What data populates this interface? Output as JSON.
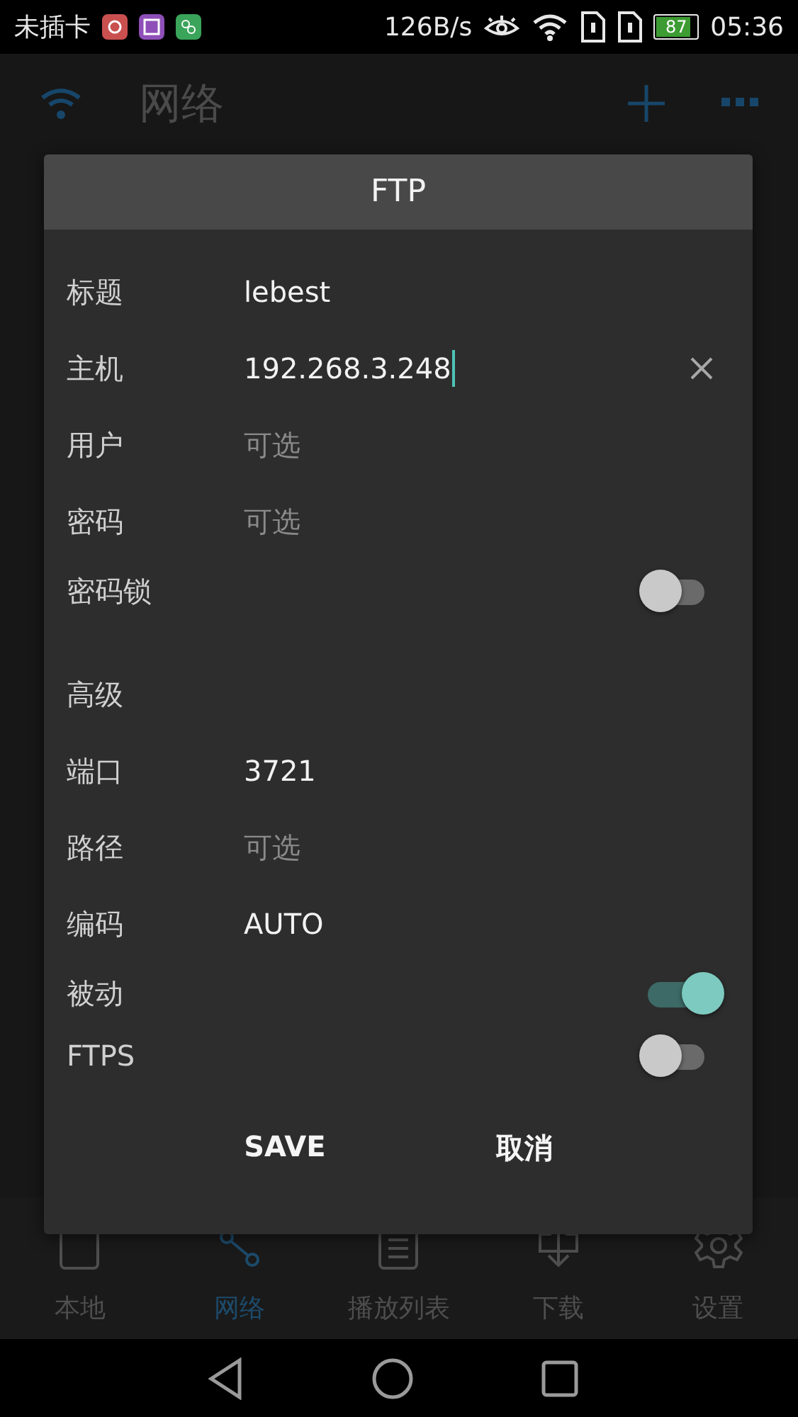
{
  "status_bar": {
    "carrier": "未插卡",
    "speed": "126B/s",
    "battery": {
      "reading": "87",
      "level": 0.87
    },
    "time": "05:36"
  },
  "app_bar": {
    "title": "网络"
  },
  "dialog": {
    "title": "FTP",
    "rows": [
      {
        "kind": "text",
        "label": "标题",
        "value": "lebest",
        "focused": false
      },
      {
        "kind": "text",
        "label": "主机",
        "value": "192.268.3.248",
        "focused": true
      },
      {
        "kind": "text",
        "label": "用户",
        "placeholder": "可选",
        "focused": false
      },
      {
        "kind": "text",
        "label": "密码",
        "placeholder": "可选",
        "focused": false
      },
      {
        "kind": "toggle",
        "label": "密码锁",
        "on": false
      },
      {
        "kind": "section",
        "label": "高级"
      },
      {
        "kind": "text",
        "label": "端口",
        "value": "3721",
        "focused": false
      },
      {
        "kind": "text",
        "label": "路径",
        "placeholder": "可选",
        "focused": false
      },
      {
        "kind": "text",
        "label": "编码",
        "value": "AUTO",
        "focused": false
      },
      {
        "kind": "toggle",
        "label": "被动",
        "on": true
      },
      {
        "kind": "toggle",
        "label": "FTPS",
        "on": false
      }
    ],
    "buttons": [
      "SAVE",
      "取消"
    ]
  },
  "bottom_nav": [
    {
      "label": "本地",
      "kind": "device",
      "selected": false
    },
    {
      "label": "网络",
      "kind": "share",
      "selected": true
    },
    {
      "label": "播放列表",
      "kind": "list",
      "selected": false
    },
    {
      "label": "下载",
      "kind": "download",
      "selected": false
    },
    {
      "label": "设置",
      "kind": "gear",
      "selected": false
    }
  ]
}
